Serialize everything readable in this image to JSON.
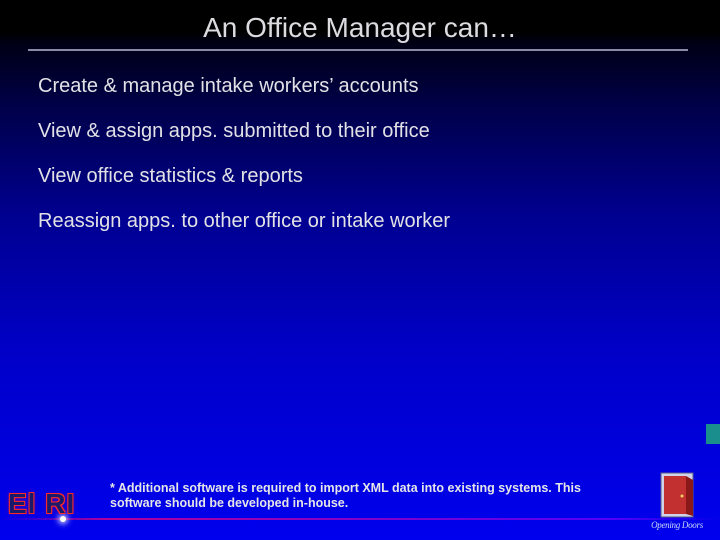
{
  "title": "An Office Manager can…",
  "bullets": [
    "Create & manage intake workers’ accounts",
    "View & assign apps. submitted to their office",
    "View office statistics & reports",
    "Reassign apps. to other office or intake worker"
  ],
  "footnote": "* Additional software is required to import XML data into existing systems. This software should be developed in-house.",
  "logo_left": "El RI",
  "logo_right": "Opening Doors"
}
